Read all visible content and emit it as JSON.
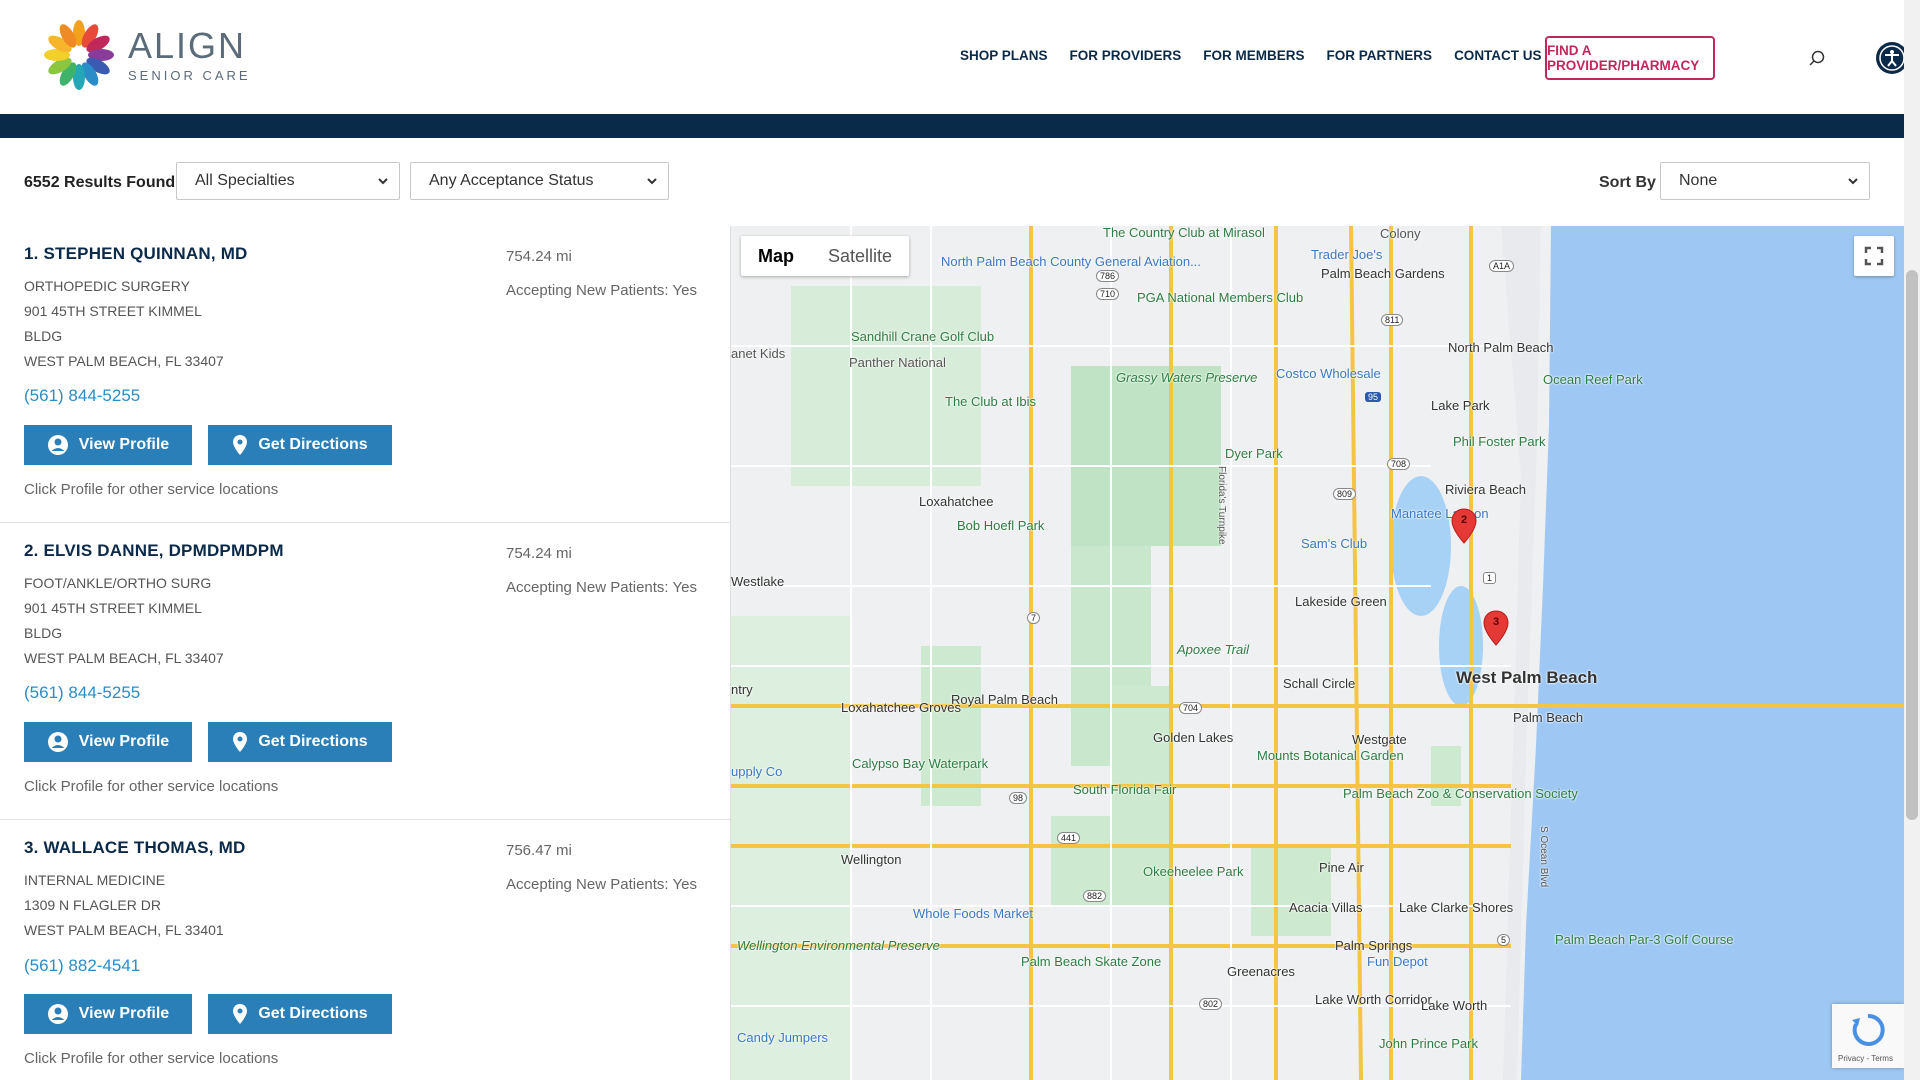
{
  "brand": {
    "name": "ALIGN",
    "sub": "SENIOR CARE"
  },
  "nav": {
    "items": [
      "SHOP PLANS",
      "FOR PROVIDERS",
      "FOR MEMBERS",
      "FOR PARTNERS",
      "CONTACT US"
    ],
    "cta": "FIND A PROVIDER/PHARMACY"
  },
  "filters": {
    "results": "6552 Results Found",
    "specialty": "All Specialties",
    "acceptance": "Any Acceptance Status",
    "sort_label": "Sort By",
    "sort_value": "None"
  },
  "providers": [
    {
      "name": "1. STEPHEN QUINNAN, MD",
      "specialty": "ORTHOPEDIC SURGERY",
      "address1": "901 45TH STREET KIMMEL",
      "address2": "BLDG",
      "city": "WEST PALM BEACH, FL 33407",
      "distance": "754.24 mi",
      "accepting": "Accepting New Patients: Yes",
      "phone": "(561) 844-5255"
    },
    {
      "name": "2. ELVIS DANNE, DPMDPMDPM",
      "specialty": "FOOT/ANKLE/ORTHO SURG",
      "address1": "901 45TH STREET KIMMEL",
      "address2": "BLDG",
      "city": "WEST PALM BEACH, FL 33407",
      "distance": "754.24 mi",
      "accepting": "Accepting New Patients: Yes",
      "phone": "(561) 844-5255"
    },
    {
      "name": "3. WALLACE THOMAS, MD",
      "specialty": "INTERNAL MEDICINE",
      "address1": "1309 N FLAGLER DR",
      "address2": "",
      "city": "WEST PALM BEACH, FL 33401",
      "distance": "756.47 mi",
      "accepting": "Accepting New Patients: Yes",
      "phone": "(561) 882-4541"
    }
  ],
  "buttons": {
    "view_profile": "View Profile",
    "get_directions": "Get Directions",
    "note": "Click Profile for other service locations"
  },
  "map": {
    "tabs": [
      "Map",
      "Satellite"
    ],
    "labels": {
      "the_country_club": "The Country Club at Mirasol",
      "colony": "Colony",
      "trader_joes": "Trader Joe's",
      "palm_beach_gardens": "Palm Beach Gardens",
      "north_palm_airport": "North Palm Beach County General Aviation...",
      "pga_national": "PGA National Members Club",
      "sandhill_crane": "Sandhill Crane Golf Club",
      "panther_national": "Panther National",
      "net_kids": "anet Kids",
      "costco": "Costco Wholesale",
      "north_palm_beach": "North Palm Beach",
      "ocean_reef_park": "Ocean Reef Park",
      "grassy_waters": "Grassy Waters Preserve",
      "club_at_ibis": "The Club at Ibis",
      "lake_park": "Lake Park",
      "phil_foster": "Phil Foster Park",
      "dyer_park": "Dyer Park",
      "loxahatchee": "Loxahatchee",
      "riviera_beach": "Riviera Beach",
      "manatee": "Manatee Lagoon",
      "bob_hoefl": "Bob Hoefl Park",
      "sams_club": "Sam's Club",
      "westlake": "Westlake",
      "lakeside_green": "Lakeside Green",
      "apoxee": "Apoxee Trail",
      "west_palm_beach": "West Palm Beach",
      "schall_circle": "Schall Circle",
      "entry": "ntry",
      "royal_palm_beach": "Royal Palm Beach",
      "loxahatchee_groves": "Loxahatchee Groves",
      "palm_beach": "Palm Beach",
      "golden_lakes": "Golden Lakes",
      "westgate": "Westgate",
      "calypso": "Calypso Bay Waterpark",
      "supply_co": "upply Co",
      "south_florida_fair": "South Florida Fair",
      "mounts": "Mounts Botanical Garden",
      "zoo": "Palm Beach Zoo & Conservation Society",
      "wellington": "Wellington",
      "okeeheelee": "Okeeheelee Park",
      "pine_air": "Pine Air",
      "whole_foods": "Whole Foods Market",
      "acacia_villas": "Acacia Villas",
      "lake_clarke": "Lake Clarke Shores",
      "wellington_preserve": "Wellington Environmental Preserve",
      "palm_springs": "Palm Springs",
      "fun_depot": "Fun Depot",
      "par3": "Palm Beach Par-3 Golf Course",
      "skate_zone": "Palm Beach Skate Zone",
      "greenacres": "Greenacres",
      "lake_worth_corridor": "Lake Worth Corridor",
      "lake_worth": "Lake Worth",
      "candy_jumpers": "Candy Jumpers",
      "john_prince": "John Prince Park",
      "floridas_turnpike": "Florida's Turnpike",
      "s_ocean_blvd": "S Ocean Blvd"
    },
    "markers": [
      "2",
      "3"
    ],
    "road_shields": [
      "786",
      "710",
      "811",
      "A1A",
      "95",
      "708",
      "809",
      "1",
      "7",
      "704",
      "98",
      "441",
      "882",
      "802",
      "5"
    ]
  },
  "recaptcha": {
    "text": "Privacy - Terms"
  }
}
